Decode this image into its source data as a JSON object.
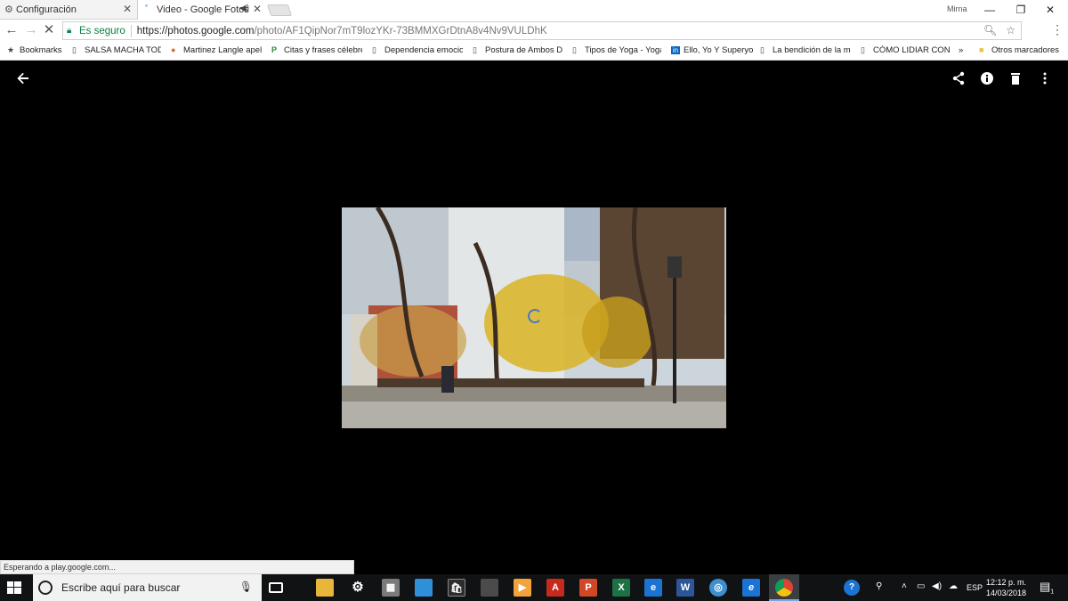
{
  "browser": {
    "tabs": [
      {
        "title": "Configuración",
        "icon": "gear-icon",
        "active": false
      },
      {
        "title": "Video - Google Fotos",
        "icon": "photos-icon",
        "active": true
      }
    ],
    "profile_name": "Mirna",
    "address": {
      "secure_label": "Es seguro",
      "url_host": "https://photos.google.com",
      "url_path": "/photo/AF1QipNor7mT9lozYKr-73BMMXGrDtnA8v4Nv9VULDhK"
    },
    "bookmarks": [
      {
        "label": "Bookmarks",
        "icon": "star-icon"
      },
      {
        "label": "SALSA MACHA TODA",
        "icon": "page-icon"
      },
      {
        "label": "Martinez Langle apel",
        "icon": "site-icon"
      },
      {
        "label": "Citas y frases célebre",
        "icon": "p-icon"
      },
      {
        "label": "Dependencia emocio",
        "icon": "page-icon"
      },
      {
        "label": "Postura de Ambos Di",
        "icon": "page-icon"
      },
      {
        "label": "Tipos de Yoga - Yoga",
        "icon": "page-icon"
      },
      {
        "label": "Ello, Yo Y Superyo",
        "icon": "linkedin-icon"
      },
      {
        "label": "La bendición de la m",
        "icon": "page-icon"
      },
      {
        "label": "CÓMO LIDIAR CON S",
        "icon": "page-icon"
      },
      {
        "label": "»",
        "icon": ""
      },
      {
        "label": "Otros marcadores",
        "icon": "folder-icon"
      }
    ],
    "status_text": "Esperando a play.google.com..."
  },
  "viewer": {
    "state": "loading",
    "toolbar": [
      "back-arrow-icon",
      "share-icon",
      "info-icon",
      "delete-icon",
      "more-options-icon"
    ]
  },
  "taskbar": {
    "search_placeholder": "Escribe aquí para buscar",
    "language": "ESP",
    "time": "12:12 p. m.",
    "date": "14/03/2018",
    "notification_count": "1"
  }
}
